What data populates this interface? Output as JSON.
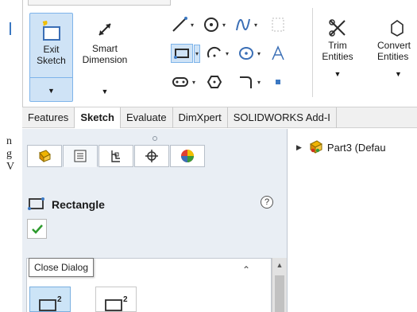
{
  "left_fragments": [
    "n",
    "g",
    "V"
  ],
  "ribbon": {
    "exit_sketch": {
      "label": "Exit Sketch",
      "icon": "exit-sketch-icon"
    },
    "smart_dimension": {
      "label": "Smart Dimension",
      "icon": "smart-dimension-icon"
    },
    "trim_entities": {
      "label": "Trim Entities",
      "icon": "trim-entities-icon"
    },
    "convert_entities": {
      "label": "Convert Entities",
      "icon": "convert-entities-icon"
    },
    "small_tools": [
      "line-icon",
      "circle-icon",
      "spline-icon",
      "rectangle-icon",
      "arc-icon",
      "ellipse-icon",
      "slot-icon",
      "polygon-icon",
      "fillet-icon",
      "text-icon",
      "point-icon",
      "plane-icon"
    ]
  },
  "tabs": [
    {
      "label": "Features",
      "active": false
    },
    {
      "label": "Sketch",
      "active": true
    },
    {
      "label": "Evaluate",
      "active": false
    },
    {
      "label": "DimXpert",
      "active": false
    },
    {
      "label": "SOLIDWORKS Add-I",
      "active": false
    }
  ],
  "property_manager": {
    "tabs": [
      "feature-manager-icon",
      "property-manager-icon",
      "configuration-manager-icon",
      "dimxpert-manager-icon",
      "display-manager-icon"
    ],
    "title": "Rectangle",
    "help_icon": "?",
    "tooltip": "Close Dialog"
  },
  "feature_tree": {
    "root_label": "Part3  (Defau"
  },
  "colors": {
    "accent": "#3b78c2",
    "selected_bg": "#cfe3f6",
    "panel_bg": "#e9eef4",
    "ok_green": "#2e9b2e"
  }
}
